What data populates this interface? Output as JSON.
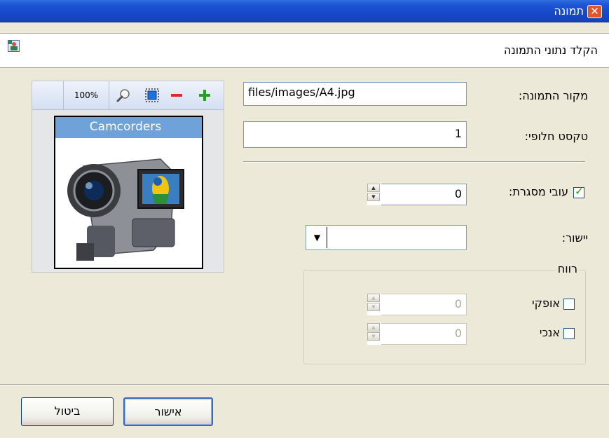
{
  "window": {
    "title": "תמונה",
    "close_glyph": "✕"
  },
  "header": {
    "heading": "הקלד נתוני התמונה",
    "icon": "image-properties-icon"
  },
  "fields": {
    "source_label": "מקור התמונה:",
    "source_value": "files/images/A4.jpg",
    "alt_label": "טקסט חלופי:",
    "alt_value": "1",
    "border_label": "עובי מסגרת:",
    "border_value": "0",
    "border_checked": true,
    "align_label": "יישור:",
    "align_value": ""
  },
  "spacing": {
    "legend": "רווח",
    "horizontal_label": "אופקי",
    "horizontal_value": "0",
    "vertical_label": "אנכי",
    "vertical_value": "0"
  },
  "preview": {
    "zoom": "100%",
    "image_caption": "Camcorders",
    "tools": [
      "zoom-icon",
      "fit-to-window-icon",
      "zoom-out-icon",
      "zoom-in-icon"
    ]
  },
  "buttons": {
    "ok": "אישור",
    "cancel": "ביטול"
  },
  "colors": {
    "titlebar": "#1748c8",
    "accent_green": "#21a121",
    "zoom_out_red": "#e0282a",
    "banner_blue": "#6fa2d8"
  }
}
